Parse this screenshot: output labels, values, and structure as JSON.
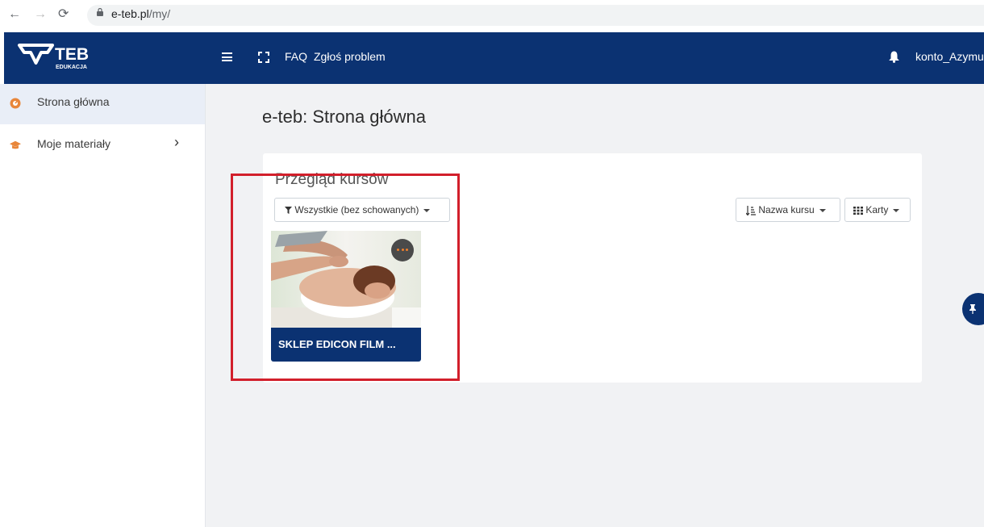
{
  "browser": {
    "url_host": "e-teb.pl",
    "url_path": "/my/"
  },
  "navbar": {
    "logo_text": "TEB",
    "logo_sub": "EDUKACJA",
    "faq": "FAQ",
    "report": "Zgłoś problem",
    "account": "konto_Azymu"
  },
  "sidebar": {
    "items": [
      {
        "label": "Strona główna",
        "icon": "dashboard-icon"
      },
      {
        "label": "Moje materiały",
        "icon": "graduation-cap-icon"
      }
    ]
  },
  "main": {
    "title": "e-teb: Strona główna",
    "overview": {
      "title": "Przegląd kursów",
      "filter": "Wszystkie (bez schowanych)",
      "sort": "Nazwa kursu",
      "view": "Karty",
      "course_name": "SKLEP EDICON FILM ..."
    }
  },
  "colors": {
    "brand": "#0b3272",
    "accent": "#f07f2b",
    "highlight": "#d21f2b"
  }
}
